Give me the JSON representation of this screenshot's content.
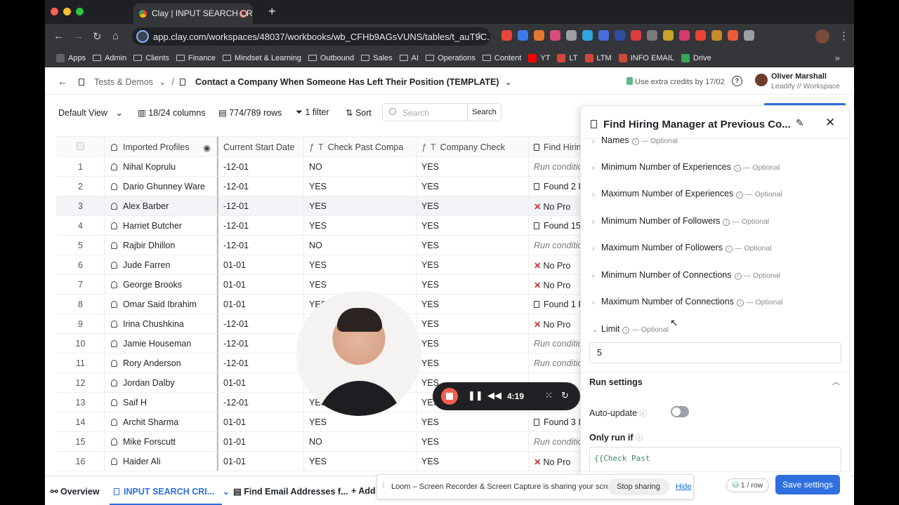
{
  "browser": {
    "tab_title": "Clay | INPUT SEARCH CRI",
    "new_tab": "+",
    "url": "app.clay.com/workspaces/48037/workbooks/wb_CFHb9AGsVUNS/tables/t_auT9C...",
    "bookmarks": [
      "Apps",
      "Admin",
      "Clients",
      "Finance",
      "Mindset & Learning",
      "Outbound",
      "Sales",
      "AI",
      "Operations",
      "Content",
      "YT",
      "LT",
      "LTM",
      "INFO EMAIL",
      "Drive"
    ]
  },
  "header": {
    "back": "←",
    "crumb_parent": "Tests & Demos",
    "crumb_sep": "/",
    "crumb_current": "Contact a Company When Someone Has Left Their Position (TEMPLATE)",
    "credits": "Use extra credits by 17/02",
    "user_name": "Oliver Marshall",
    "user_org": "Leadify // Workspace"
  },
  "toolbar": {
    "view": "Default View",
    "columns": "18/24 columns",
    "rows": "774/789 rows",
    "filter": "1 filter",
    "sort": "Sort",
    "search_placeholder": "Search",
    "search_button": "Search"
  },
  "grid": {
    "headers": [
      "Imported Profiles",
      "Current Start Date",
      "Check Past Compa",
      "Company Check",
      "Find Hirin"
    ],
    "rows": [
      {
        "n": "1",
        "name": "Nihal Koprulu",
        "date": "-12-01",
        "past": "NO",
        "company": "YES",
        "find": "Run condition",
        "kind": "run"
      },
      {
        "n": "2",
        "name": "Dario Ghunney Ware",
        "date": "-12-01",
        "past": "YES",
        "company": "YES",
        "find": "Found 2 I",
        "kind": "found"
      },
      {
        "n": "3",
        "name": "Alex Barber",
        "date": "-12-01",
        "past": "YES",
        "company": "YES",
        "find": "No Pro",
        "kind": "no"
      },
      {
        "n": "4",
        "name": "Harriet Butcher",
        "date": "-12-01",
        "past": "YES",
        "company": "YES",
        "find": "Found 15",
        "kind": "found"
      },
      {
        "n": "5",
        "name": "Rajbir Dhillon",
        "date": "-12-01",
        "past": "NO",
        "company": "YES",
        "find": "Run condition",
        "kind": "run"
      },
      {
        "n": "6",
        "name": "Jude Farren",
        "date": "01-01",
        "past": "YES",
        "company": "YES",
        "find": "No Pro",
        "kind": "no"
      },
      {
        "n": "7",
        "name": "George Brooks",
        "date": "01-01",
        "past": "YES",
        "company": "YES",
        "find": "No Pro",
        "kind": "no"
      },
      {
        "n": "8",
        "name": "Omar Said Ibrahim",
        "date": "01-01",
        "past": "YES",
        "company": "YES",
        "find": "Found 1 F",
        "kind": "found"
      },
      {
        "n": "9",
        "name": "Irina Chushkina",
        "date": "-12-01",
        "past": "",
        "company": "YES",
        "find": "No Pro",
        "kind": "no"
      },
      {
        "n": "10",
        "name": "Jamie Houseman",
        "date": "-12-01",
        "past": "",
        "company": "YES",
        "find": "Run condition",
        "kind": "run"
      },
      {
        "n": "11",
        "name": "Rory Anderson",
        "date": "-12-01",
        "past": "",
        "company": "YES",
        "find": "Run condition",
        "kind": "run"
      },
      {
        "n": "12",
        "name": "Jordan Dalby",
        "date": "01-01",
        "past": "",
        "company": "YES",
        "find": "",
        "kind": "run"
      },
      {
        "n": "13",
        "name": "Saif H",
        "date": "-12-01",
        "past": "YES",
        "company": "YES",
        "find": "",
        "kind": "run"
      },
      {
        "n": "14",
        "name": "Archit Sharma",
        "date": "01-01",
        "past": "YES",
        "company": "YES",
        "find": "Found 3 I",
        "kind": "found"
      },
      {
        "n": "15",
        "name": "Mike Forscutt",
        "date": "01-01",
        "past": "NO",
        "company": "YES",
        "find": "Run condition",
        "kind": "run"
      },
      {
        "n": "16",
        "name": "Haider Ali",
        "date": "01-01",
        "past": "YES",
        "company": "YES",
        "find": "No Pro",
        "kind": "no"
      }
    ]
  },
  "bottom_tabs": {
    "overview": "Overview",
    "input": "INPUT SEARCH CRI...",
    "email": "Find Email Addresses f...",
    "add": "Add"
  },
  "panel": {
    "title": "Find Hiring Manager at Previous Co...",
    "optional": "— Optional",
    "fields": [
      "Names",
      "Minimum Number of Experiences",
      "Maximum Number of Experiences",
      "Minimum Number of Followers",
      "Maximum Number of Followers",
      "Minimum Number of Connections",
      "Maximum Number of Connections",
      "Limit"
    ],
    "limit_value": "5",
    "run_settings": "Run settings",
    "auto_update": "Auto-update",
    "only_run_if": "Only run if",
    "condition": "{{Check Past",
    "row_cost": "1 / row",
    "save": "Save settings"
  },
  "loom": {
    "time": "4:19",
    "share_text": "Loom – Screen Recorder & Screen Capture is sharing your screen.",
    "stop_sharing": "Stop sharing",
    "hide": "Hide"
  },
  "colors": {
    "accent": "#2f6fdf",
    "no": "#d32f2f",
    "loom_red": "#f25f4c"
  }
}
